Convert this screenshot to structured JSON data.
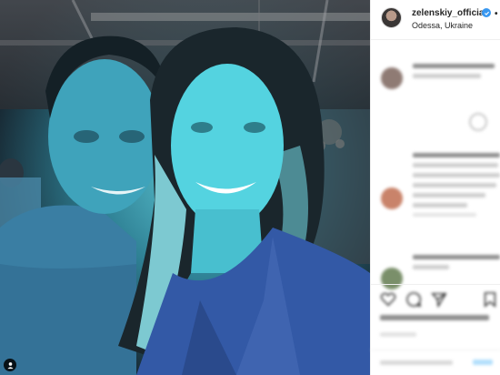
{
  "post": {
    "username": "zelenskiy_official",
    "location": "Odessa, Ukraine",
    "verified": true,
    "more_indicator": "•",
    "photo_icons": {
      "tag": "user-tag-icon"
    },
    "action_icons": [
      "heart-icon",
      "comment-icon",
      "share-icon",
      "bookmark-icon"
    ]
  },
  "comments": [
    {
      "avatar_color": "#8f7b74",
      "lines": 2
    },
    {
      "avatar_color": "#c9836a",
      "lines": 5
    },
    {
      "avatar_color": "#7a8f6a",
      "lines": 2
    }
  ],
  "colors": {
    "verified": "#3897f0",
    "text": "#262626",
    "divider": "#efefef"
  }
}
